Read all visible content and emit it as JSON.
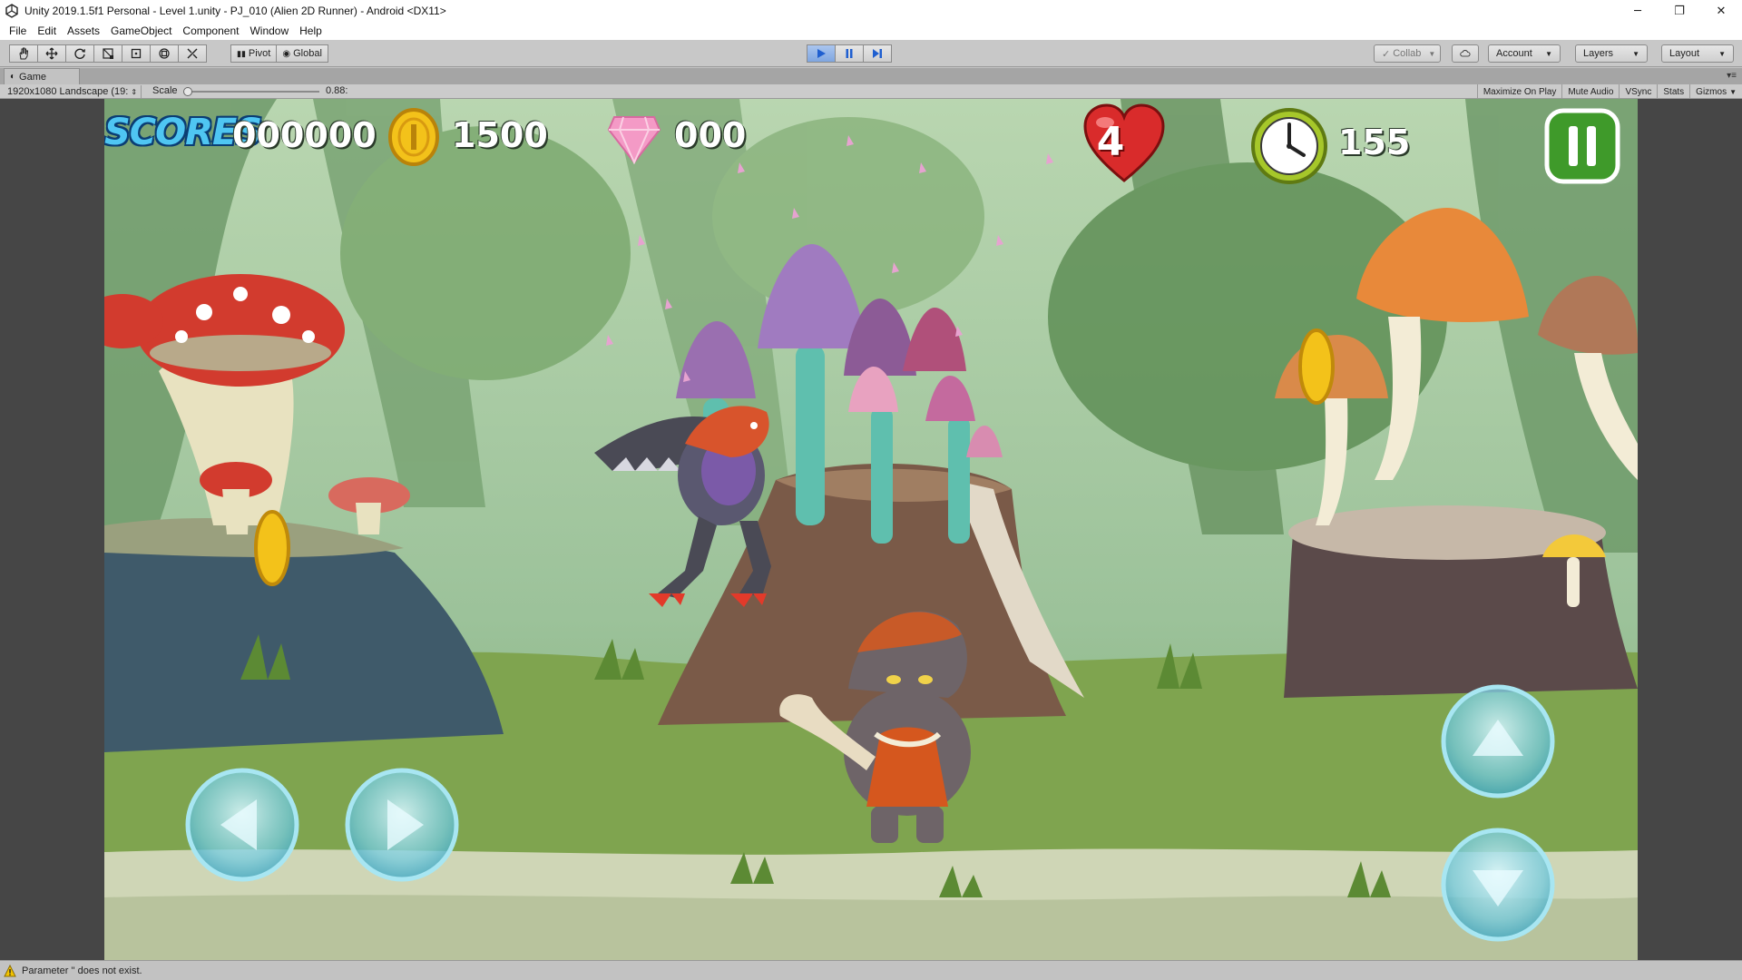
{
  "window": {
    "title": "Unity 2019.1.5f1 Personal - Level 1.unity - PJ_010 (Alien 2D Runner) - Android <DX11>",
    "controls": {
      "minimize": "─",
      "maximize": "❐",
      "close": "✕"
    }
  },
  "menu": [
    "File",
    "Edit",
    "Assets",
    "GameObject",
    "Component",
    "Window",
    "Help"
  ],
  "toolbar": {
    "pivot_label": "Pivot",
    "global_label": "Global",
    "collab_label": "Collab",
    "account_label": "Account",
    "layers_label": "Layers",
    "layout_label": "Layout",
    "play_state": "playing"
  },
  "game_tab": {
    "label": "Game"
  },
  "game_view": {
    "resolution": "1920x1080 Landscape (19:",
    "scale_label": "Scale",
    "scale_value": "0.88:",
    "scale_fraction": 0.02,
    "toggles": [
      "Maximize On Play",
      "Mute Audio",
      "VSync",
      "Stats",
      "Gizmos"
    ]
  },
  "hud": {
    "scores_label": "SCORES",
    "scores_value": "000000",
    "coins_value": "1500",
    "gems_value": "000",
    "lives_value": "4",
    "timer_value": "155"
  },
  "colors": {
    "scores_label": "#4fc6f2",
    "pause_button": "#3f9a2a",
    "heart": "#d92b2b",
    "coin": "#f3c21a",
    "gem": "#f49ac6",
    "touch_buttons": "#7fd6e6"
  },
  "touch_controls": [
    "left-arrow",
    "right-arrow",
    "up-arrow",
    "down-arrow"
  ],
  "status": {
    "message": "Parameter '' does not exist."
  }
}
